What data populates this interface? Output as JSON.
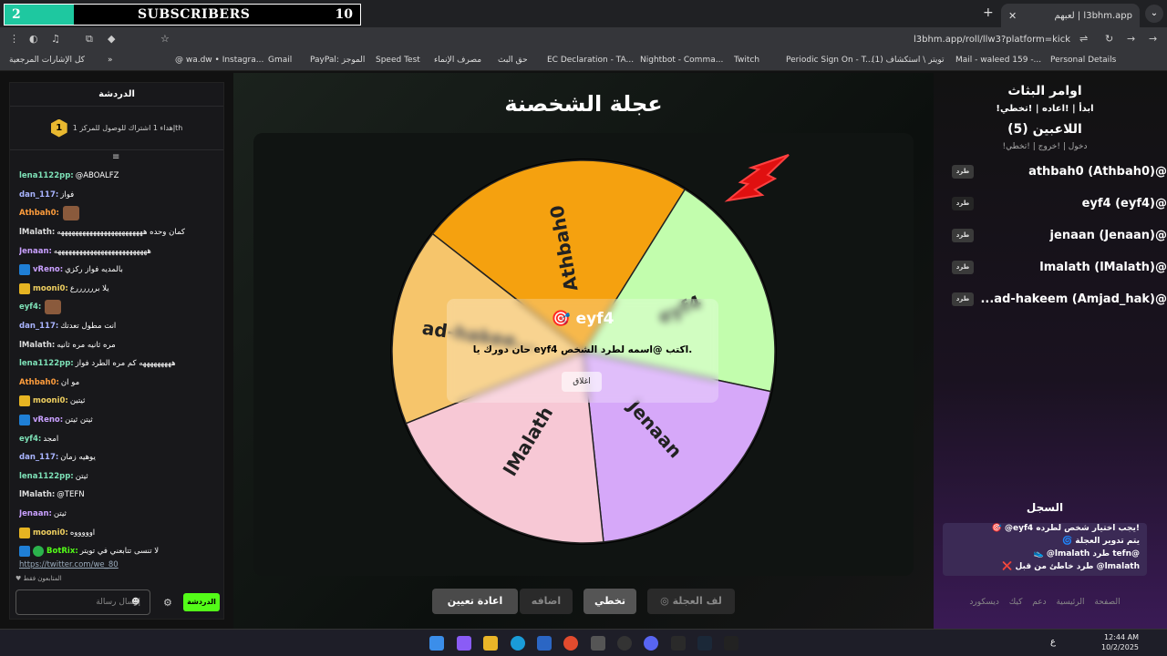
{
  "overlay": {
    "left_count": "2",
    "label": "SUBSCRIBERS",
    "right_count": "10"
  },
  "browser": {
    "tab_title": "لعبهم | l3bhm.app",
    "url": "l3bhm.app/roll/llw3?platform=kick",
    "bookmarks": [
      "Personal Details",
      "Mail - waleed 159 -...",
      "(1) تويتر \\ استكشاف",
      "Periodic Sign On - T...",
      "Twitch",
      "Nightbot - Comma...",
      "EC Declaration - TA...",
      "حق البث",
      "مصرف الإنماء",
      "Speed Test",
      "PayPal: الموجز",
      "Gmail",
      "@ wa.dw • Instagra..."
    ],
    "all_bookmarks": "كل الإشارات المرجعية"
  },
  "chat": {
    "header": "الدردشة",
    "pinned_rank": "1",
    "pinned": "إهداء 1 اشتراك للوصول للمركز 1th",
    "messages": [
      {
        "user": "lena1122pp",
        "color": "#7ee2b8",
        "text": "@ABOALFZ",
        "badge": ""
      },
      {
        "user": "dan_117",
        "color": "#a9b4ff",
        "text": "فواز",
        "badge": ""
      },
      {
        "user": "Athbah0",
        "color": "#ff9d3c",
        "text": "",
        "badge": "",
        "emote": true
      },
      {
        "user": "lMalath",
        "color": "#dddddd",
        "text": "كمان وحده ههههههههههههههههههههههههه",
        "badge": ""
      },
      {
        "user": "Jenaan",
        "color": "#c9a0ff",
        "text": "ههههههههههههههههههههههههههه",
        "badge": ""
      },
      {
        "user": "vReno",
        "color": "#c9a0ff",
        "text": "بالمديه فواز ركزي",
        "badge": "blue"
      },
      {
        "user": "mooni0",
        "color": "#f0d060",
        "text": "يلا بررررررع",
        "badge": "gold"
      },
      {
        "user": "eyf4",
        "color": "#7ee2b8",
        "text": "",
        "badge": "",
        "emote": true
      },
      {
        "user": "dan_117",
        "color": "#a9b4ff",
        "text": "انت مطول تعدتك",
        "badge": ""
      },
      {
        "user": "lMalath",
        "color": "#dddddd",
        "text": "مره ثانيه مره ثانيه",
        "badge": ""
      },
      {
        "user": "lena1122pp",
        "color": "#7ee2b8",
        "text": "هههههههههه كم مره الطرد فواز",
        "badge": ""
      },
      {
        "user": "Athbah0",
        "color": "#ff9d3c",
        "text": "مو ان",
        "badge": ""
      },
      {
        "user": "mooni0",
        "color": "#f0d060",
        "text": "ثيتين",
        "badge": "gold"
      },
      {
        "user": "vReno",
        "color": "#c9a0ff",
        "text": "ثيتن ثيتن",
        "badge": "blue"
      },
      {
        "user": "eyf4",
        "color": "#7ee2b8",
        "text": "امجد",
        "badge": ""
      },
      {
        "user": "dan_117",
        "color": "#a9b4ff",
        "text": "يوهيه زمان",
        "badge": ""
      },
      {
        "user": "lena1122pp",
        "color": "#7ee2b8",
        "text": "ثيتن",
        "badge": ""
      },
      {
        "user": "lMalath",
        "color": "#dddddd",
        "text": "@TEFN",
        "badge": ""
      },
      {
        "user": "Jenaan",
        "color": "#c9a0ff",
        "text": "ثيتن",
        "badge": ""
      },
      {
        "user": "mooni0",
        "color": "#f0d060",
        "text": "اوووووه",
        "badge": "gold"
      },
      {
        "user": "BotRix",
        "color": "#53fc18",
        "text": "لا تنسى تتابعني في تويتر",
        "badge": "bot"
      }
    ],
    "link": "https://twitter.com/we_80",
    "followers_only": "المتابعون فقط",
    "input_placeholder": "إرسال رسالة",
    "send_button": "الدردشة"
  },
  "wheel": {
    "title": "عجلة الشخصنة",
    "segments": [
      {
        "name": "Athbah0",
        "color": "#f5a10f"
      },
      {
        "name": "eyf4",
        "color": "#c2fdad"
      },
      {
        "name": "Jenaan",
        "color": "#d6a8f9"
      },
      {
        "name": "lMalath",
        "color": "#f7c8d5"
      },
      {
        "name": "ad-hakee...",
        "color": "#f6c56b"
      }
    ],
    "modal": {
      "title": "eyf4",
      "icon": "🎯",
      "desc": "حان دورك يا eyf4 اكتب @اسمه لطرد الشخص.",
      "close": "اغلاق"
    },
    "buttons": {
      "spin": "لف العجلة",
      "skip": "تخطي",
      "add": "اضافه",
      "reset": "اعادة تعيين"
    }
  },
  "side": {
    "heading": "اوامر البثاث",
    "commands": "!ابدأ | !اعاده | !تخطي",
    "players_label": "اللاعبين (5)",
    "player_cmds": "!دخول | !خروج | !تخطي",
    "players": [
      "athbah0 (Athbah0)@",
      "eyf4 (eyf4)@",
      "jenaan (Jenaan)@",
      "lmalath (lMalath)@",
      "...ad-hakeem (Amjad_hak)@"
    ],
    "kick": "طرد",
    "log_title": "السجل",
    "log": [
      "🎯 @eyf4 يجب اختيار شخص لطرده!",
      "🌀 يتم تدوير العجلة",
      "👟 @lmalath طرد tefn@",
      "❌ طرد خاطئ من قبل @lmalath"
    ],
    "footer": "الصفحة الرئيسية دعم كيك ديسكورد"
  },
  "taskbar": {
    "time": "12:44 AM",
    "date": "10/2/2025",
    "lang": "ع"
  }
}
